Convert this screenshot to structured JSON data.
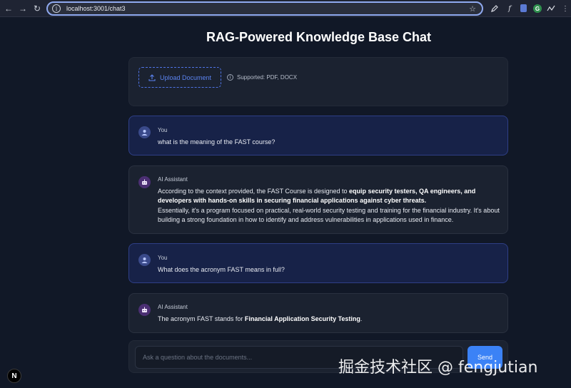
{
  "browser": {
    "url": "localhost:3001/chat3",
    "back_icon": "←",
    "forward_icon": "→",
    "reload_icon": "↻",
    "star_icon": "☆",
    "fx_icon": "f"
  },
  "page": {
    "title": "RAG-Powered Knowledge Base Chat"
  },
  "upload": {
    "button_label": "Upload Document",
    "supported_text": "Supported: PDF, DOCX"
  },
  "messages": [
    {
      "sender": "You",
      "text": "what is the meaning of the FAST course?"
    },
    {
      "sender": "AI Assistant",
      "p1_pre": "According to the context provided, the FAST Course is designed to ",
      "p1_bold": "equip security testers, QA engineers, and developers with hands-on skills in securing financial applications against cyber threats.",
      "p2": "Essentially, it's a program focused on practical, real-world security testing and training for the financial industry. It's about building a strong foundation in how to identify and address vulnerabilities in applications used in finance."
    },
    {
      "sender": "You",
      "text": "What does the acronym FAST means in full?"
    },
    {
      "sender": "AI Assistant",
      "pre": "The acronym FAST stands for ",
      "bold": "Financial Application Security Testing",
      "post": "."
    }
  ],
  "input": {
    "placeholder": "Ask a question about the documents...",
    "send_label": "Send"
  },
  "badge": {
    "letter": "N"
  },
  "watermark": "掘金技术社区 @ fengjutian",
  "colors": {
    "background": "#111827",
    "accent": "#3b82f6",
    "user_bubble": "#172248",
    "ai_bubble": "#1b2230"
  }
}
